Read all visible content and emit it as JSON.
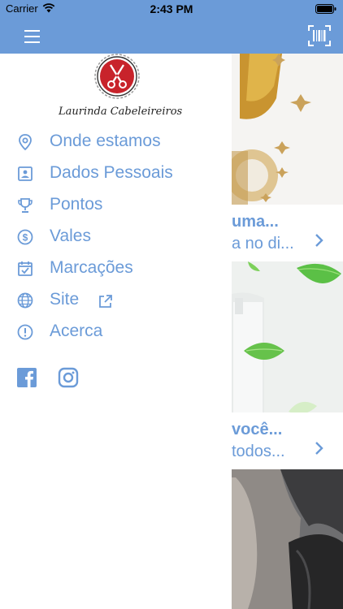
{
  "status_bar": {
    "carrier": "Carrier",
    "time": "2:43 PM"
  },
  "brand": {
    "name": "Laurinda Cabeleireiros",
    "accent_color": "#6b9bd8",
    "logo_color": "#c8232b"
  },
  "drawer": {
    "items": [
      {
        "label": "Onde estamos",
        "icon": "location-pin-icon"
      },
      {
        "label": "Dados Pessoais",
        "icon": "contact-card-icon"
      },
      {
        "label": "Pontos",
        "icon": "trophy-icon"
      },
      {
        "label": "Vales",
        "icon": "dollar-coin-icon"
      },
      {
        "label": "Marcações",
        "icon": "calendar-check-icon"
      },
      {
        "label": "Site",
        "icon": "globe-icon",
        "external_icon": "external-link-icon"
      },
      {
        "label": "Acerca",
        "icon": "info-circle-icon"
      }
    ],
    "social": [
      "facebook-icon",
      "instagram-icon"
    ]
  },
  "feed": {
    "cards": [
      {
        "title": "uma...",
        "subtitle": "a no di..."
      },
      {
        "title": "você...",
        "subtitle": "todos..."
      }
    ]
  }
}
